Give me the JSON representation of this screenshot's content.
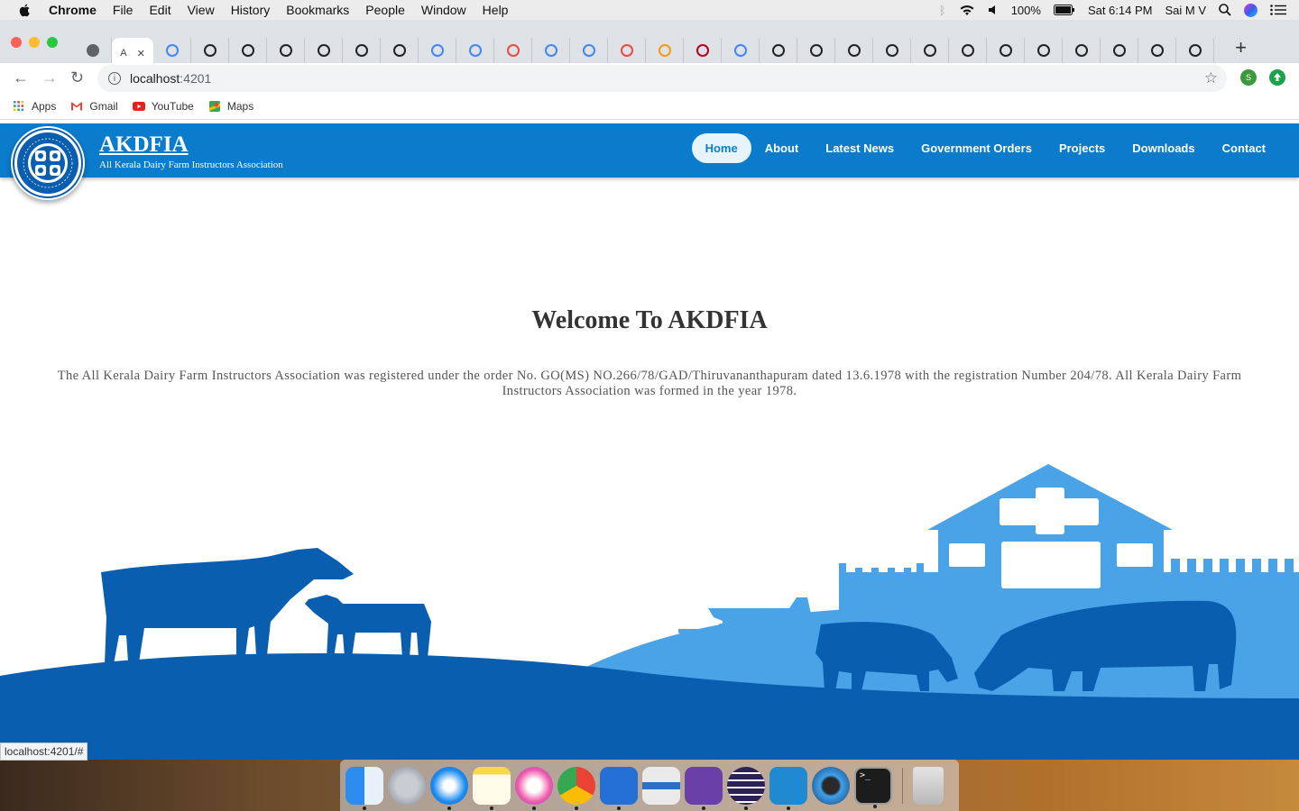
{
  "menubar": {
    "app_name": "Chrome",
    "items": [
      "File",
      "Edit",
      "View",
      "History",
      "Bookmarks",
      "People",
      "Window",
      "Help"
    ],
    "battery": "100%",
    "clock": "Sat 6:14 PM",
    "user": "Sai M V"
  },
  "tabs": {
    "active_label": "A",
    "close_symbol": "✕",
    "new_tab_symbol": "+"
  },
  "toolbar": {
    "url_host": "localhost",
    "url_port": ":4201",
    "ext1_letter": "S"
  },
  "bookmarks": {
    "items": [
      "Apps",
      "Gmail",
      "YouTube",
      "Maps"
    ]
  },
  "site": {
    "brand_name": "AKDFIA",
    "brand_sub": "All Kerala Dairy Farm Instructors Association",
    "nav": [
      "Home",
      "About",
      "Latest News",
      "Government Orders",
      "Projects",
      "Downloads",
      "Contact"
    ],
    "welcome_title": "Welcome To AKDFIA",
    "welcome_text": "The All Kerala Dairy Farm Instructors Association was registered under the order No. GO(MS) NO.266/78/GAD/Thiruvananthapuram dated 13.6.1978 with the registration Number 204/78. All Kerala Dairy Farm Instructors Association was formed in the year 1978.",
    "logo_text": "ALL KERALA DAIRY FARM INSTRUCTORS ASSOCIATION"
  },
  "status_bar_url": "localhost:4201/#",
  "colors": {
    "brand_blue": "#0b7ccb",
    "dark_blue": "#0a5eb0",
    "light_blue": "#4aa3e6"
  }
}
